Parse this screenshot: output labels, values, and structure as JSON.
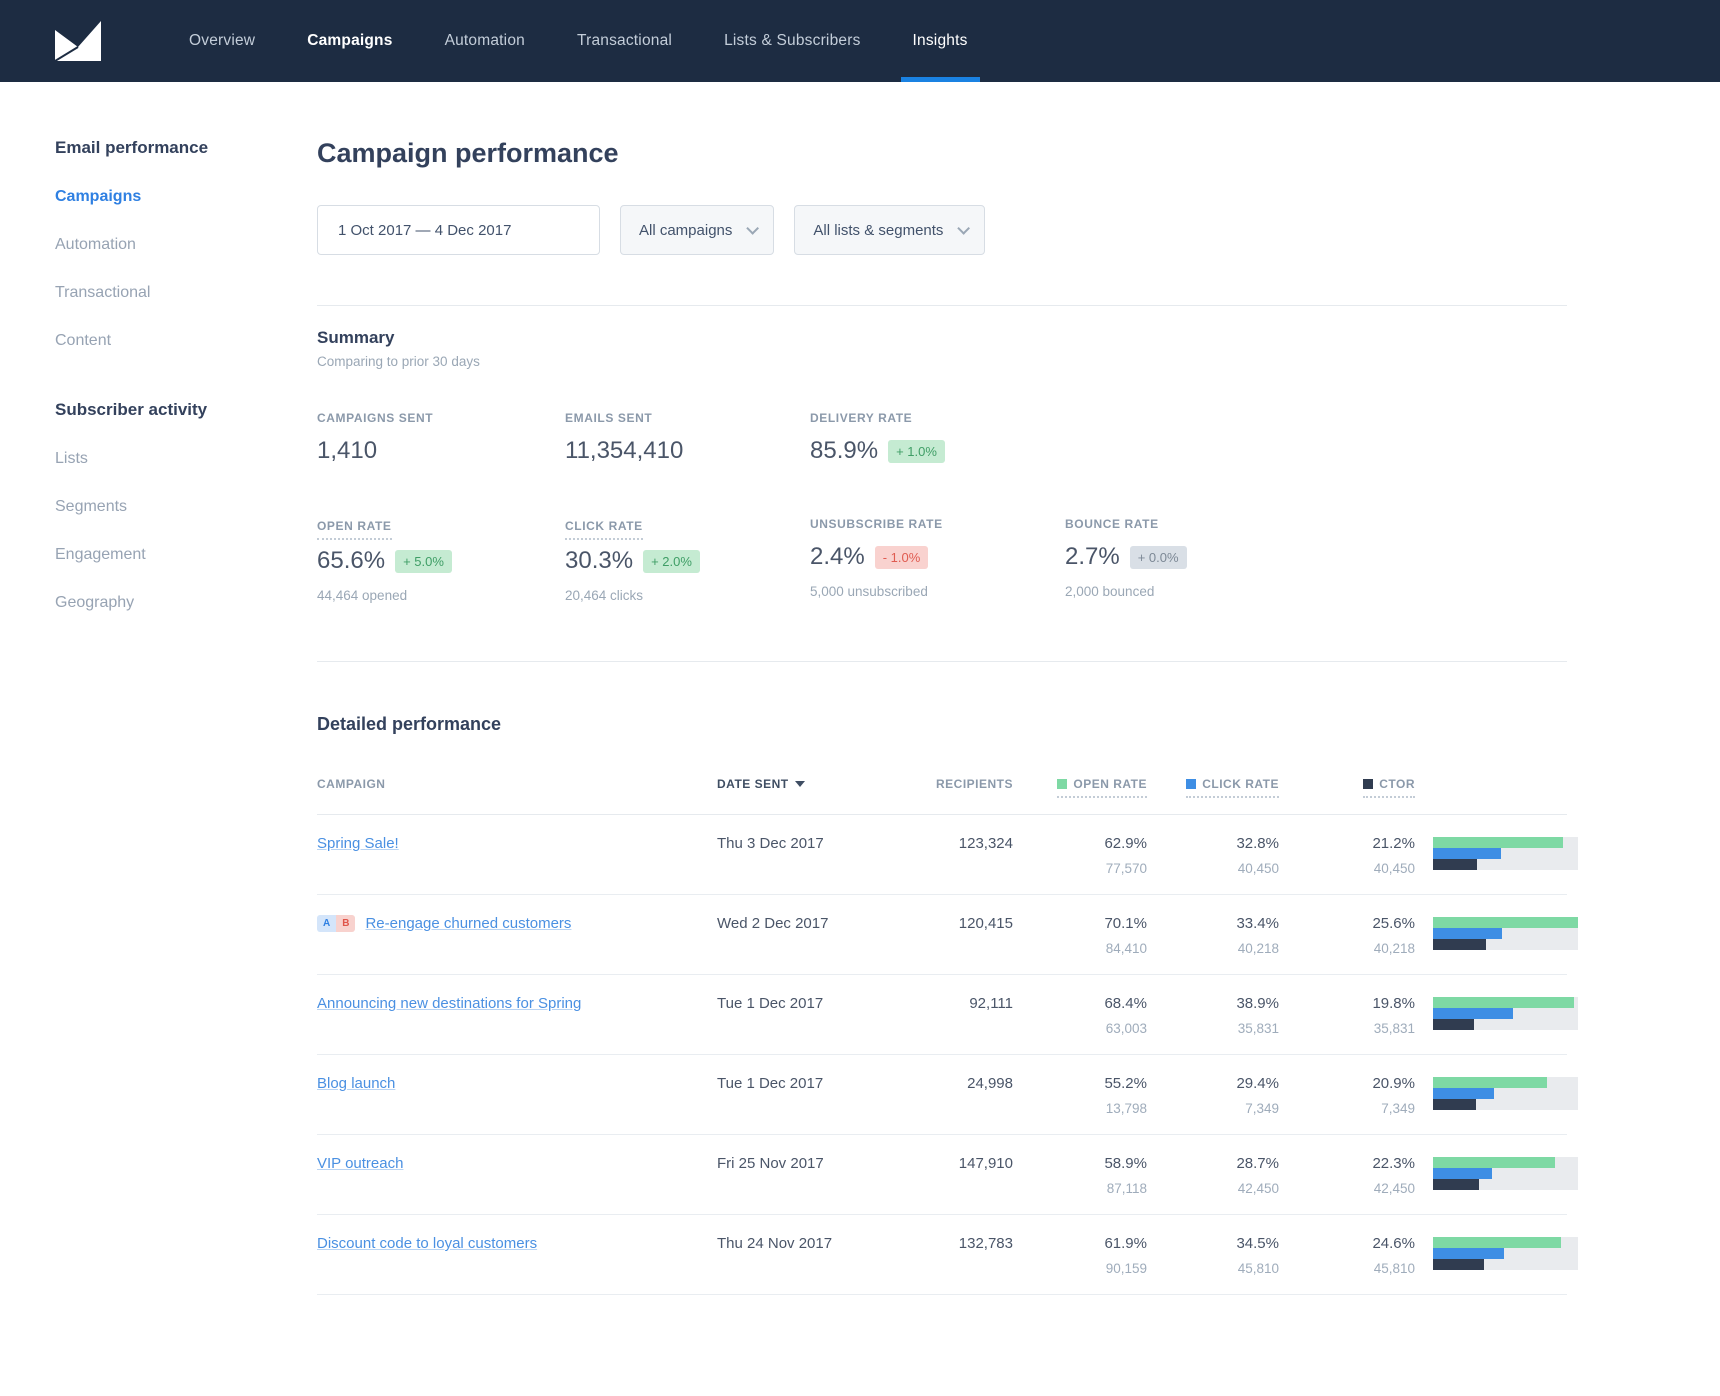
{
  "nav": {
    "logo": "campaign-monitor-logo",
    "items": [
      {
        "label": "Overview",
        "active": false
      },
      {
        "label": "Campaigns",
        "active": false
      },
      {
        "label": "Automation",
        "active": false
      },
      {
        "label": "Transactional",
        "active": false
      },
      {
        "label": "Lists & Subscribers",
        "active": false
      },
      {
        "label": "Insights",
        "active": true
      }
    ]
  },
  "sidebar": {
    "sections": [
      {
        "heading": "Email performance",
        "items": [
          {
            "label": "Campaigns",
            "active": true
          },
          {
            "label": "Automation",
            "active": false
          },
          {
            "label": "Transactional",
            "active": false
          },
          {
            "label": "Content",
            "active": false
          }
        ]
      },
      {
        "heading": "Subscriber activity",
        "items": [
          {
            "label": "Lists",
            "active": false
          },
          {
            "label": "Segments",
            "active": false
          },
          {
            "label": "Engagement",
            "active": false
          },
          {
            "label": "Geography",
            "active": false
          }
        ]
      }
    ]
  },
  "page": {
    "title": "Campaign performance"
  },
  "filters": {
    "date_range": "1 Oct 2017 — 4 Dec 2017",
    "campaigns_label": "All campaigns",
    "lists_label": "All lists & segments"
  },
  "summary": {
    "heading": "Summary",
    "subheading": "Comparing to prior 30 days",
    "row1": [
      {
        "label": "CAMPAIGNS SENT",
        "value": "1,410"
      },
      {
        "label": "EMAILS SENT",
        "value": "11,354,410"
      },
      {
        "label": "DELIVERY RATE",
        "value": "85.9%",
        "delta": "+ 1.0%",
        "delta_type": "positive"
      }
    ],
    "row2": [
      {
        "label": "OPEN RATE",
        "value": "65.6%",
        "delta": "+ 5.0%",
        "delta_type": "positive",
        "sub": "44,464 opened"
      },
      {
        "label": "CLICK RATE",
        "value": "30.3%",
        "delta": "+ 2.0%",
        "delta_type": "positive",
        "sub": "20,464 clicks"
      },
      {
        "label": "UNSUBSCRIBE RATE",
        "value": "2.4%",
        "delta": "- 1.0%",
        "delta_type": "negative",
        "sub": "5,000 unsubscribed"
      },
      {
        "label": "BOUNCE RATE",
        "value": "2.7%",
        "delta": "+ 0.0%",
        "delta_type": "neutral",
        "sub": "2,000 bounced"
      }
    ]
  },
  "detailed": {
    "heading": "Detailed performance",
    "columns": {
      "campaign": "CAMPAIGN",
      "date_sent": "DATE SENT",
      "recipients": "RECIPIENTS",
      "open_rate": "OPEN RATE",
      "click_rate": "CLICK RATE",
      "ctor": "CTOR"
    },
    "ab_badge": {
      "a": "A",
      "b": "B"
    },
    "bar_scale_max": 70.1,
    "rows": [
      {
        "name": "Spring Sale!",
        "ab_test": false,
        "date": "Thu 3 Dec 2017",
        "recipients": "123,324",
        "open_rate": "62.9%",
        "open_count": "77,570",
        "click_rate": "32.8%",
        "click_count": "40,450",
        "ctor": "21.2%",
        "ctor_count": "40,450"
      },
      {
        "name": "Re-engage churned customers",
        "ab_test": true,
        "date": "Wed 2 Dec 2017",
        "recipients": "120,415",
        "open_rate": "70.1%",
        "open_count": "84,410",
        "click_rate": "33.4%",
        "click_count": "40,218",
        "ctor": "25.6%",
        "ctor_count": "40,218"
      },
      {
        "name": "Announcing new destinations for Spring",
        "ab_test": false,
        "date": "Tue 1 Dec 2017",
        "recipients": "92,111",
        "open_rate": "68.4%",
        "open_count": "63,003",
        "click_rate": "38.9%",
        "click_count": "35,831",
        "ctor": "19.8%",
        "ctor_count": "35,831"
      },
      {
        "name": "Blog launch",
        "ab_test": false,
        "date": "Tue 1 Dec 2017",
        "recipients": "24,998",
        "open_rate": "55.2%",
        "open_count": "13,798",
        "click_rate": "29.4%",
        "click_count": "7,349",
        "ctor": "20.9%",
        "ctor_count": "7,349"
      },
      {
        "name": "VIP outreach",
        "ab_test": false,
        "date": "Fri 25 Nov 2017",
        "recipients": "147,910",
        "open_rate": "58.9%",
        "open_count": "87,118",
        "click_rate": "28.7%",
        "click_count": "42,450",
        "ctor": "22.3%",
        "ctor_count": "42,450"
      },
      {
        "name": "Discount code to loyal customers",
        "ab_test": false,
        "date": "Thu 24 Nov 2017",
        "recipients": "132,783",
        "open_rate": "61.9%",
        "open_count": "90,159",
        "click_rate": "34.5%",
        "click_count": "45,810",
        "ctor": "24.6%",
        "ctor_count": "45,810"
      }
    ]
  },
  "colors": {
    "nav_background": "#1d2c42",
    "accent_blue": "#1a82e2",
    "link_blue": "#4a90e2",
    "bar_open_green": "#7ed9a4",
    "bar_click_blue": "#3e8ee4",
    "bar_ctor_navy": "#303c50",
    "delta_positive_bg": "#c5ebd2",
    "delta_negative_bg": "#f9d2cf",
    "delta_neutral_bg": "#d9dfe6"
  }
}
